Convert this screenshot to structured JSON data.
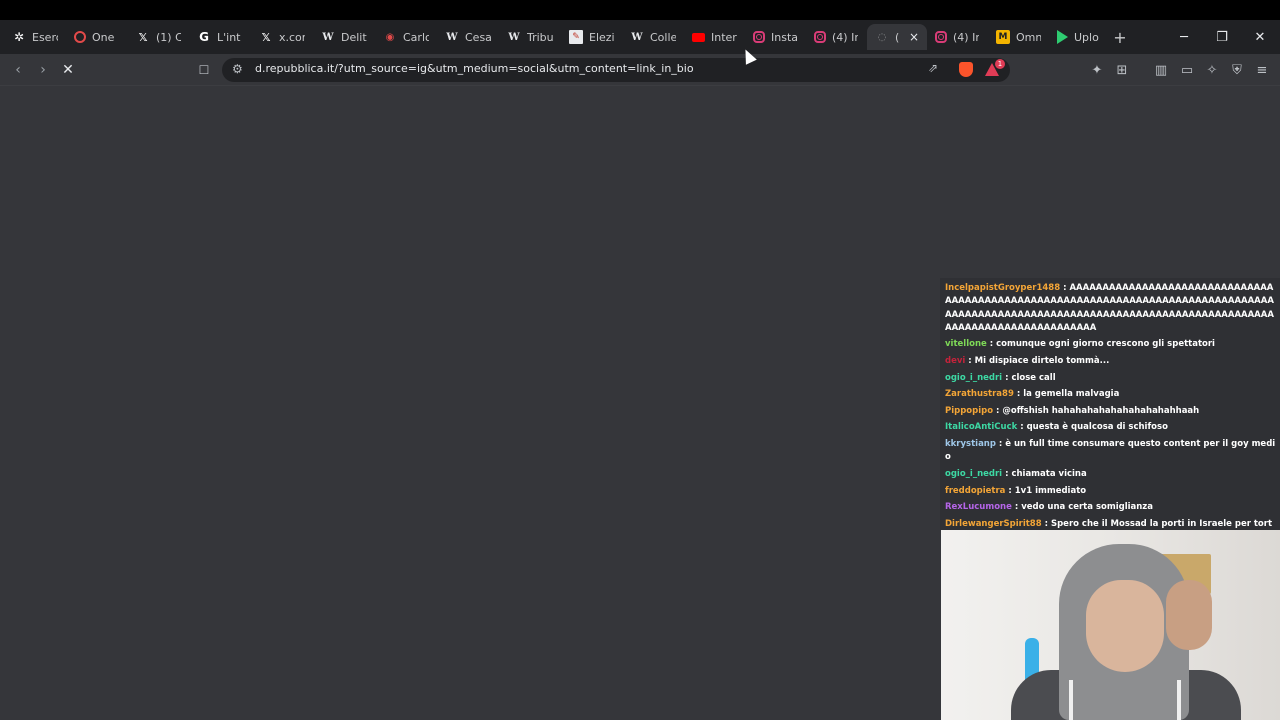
{
  "browser": {
    "tabs": [
      {
        "title": "Eserc",
        "icon": "openai-icon"
      },
      {
        "title": "One P",
        "icon": "onepiece-icon"
      },
      {
        "title": "(1) C",
        "icon": "x-icon"
      },
      {
        "title": "L'int",
        "icon": "google-icon"
      },
      {
        "title": "x.con",
        "icon": "x-icon"
      },
      {
        "title": "Delit",
        "icon": "wikipedia-icon"
      },
      {
        "title": "Carlo",
        "icon": "brave-icon"
      },
      {
        "title": "Cesa",
        "icon": "wikipedia-icon"
      },
      {
        "title": "Tribu",
        "icon": "wikipedia-icon"
      },
      {
        "title": "Elezi",
        "icon": "document-icon"
      },
      {
        "title": "Colle",
        "icon": "wikipedia-icon"
      },
      {
        "title": "Inter",
        "icon": "youtube-icon"
      },
      {
        "title": "Insta",
        "icon": "instagram-icon"
      },
      {
        "title": "(4) In",
        "icon": "instagram-icon"
      },
      {
        "title": "(",
        "icon": "loading-icon"
      },
      {
        "title": "(4) In",
        "icon": "instagram-icon"
      },
      {
        "title": "Omn",
        "icon": "m-icon"
      },
      {
        "title": "Uplo",
        "icon": "play-icon"
      }
    ],
    "close_tab_glyph": "×",
    "new_tab_glyph": "+",
    "window_controls": {
      "minimize": "─",
      "maximize": "❐",
      "close": "✕"
    },
    "url": "d.repubblica.it/?utm_source=ig&utm_medium=social&utm_content=link_in_bio"
  },
  "chat": {
    "messages": [
      {
        "user": "IncelpapistGroyper1488",
        "color": "#f3a537",
        "text": "AAAAAAAAAAAAAAAAAAAAAAAAAAAAAAAAAAAAAAAAAAAAAAAAAAAAAAAAAAAAAAAAAAAAAAAAAAAAAAAAAAAAAAAAAAAAAAAAAAAAAAAAAAAAAAAAAAAAAAAAAAAAAAAAAAAAAAAAAAAAAAAAAAAAAAAAAA"
      },
      {
        "user": "vitellone",
        "color": "#7ed957",
        "text": "comunque ogni giorno crescono gli spettatori"
      },
      {
        "user": "devi",
        "color": "#c4233b",
        "text": "Mi dispiace dirtelo tommà..."
      },
      {
        "user": "ogio_i_nedri",
        "color": "#3dd9a4",
        "text": "close call"
      },
      {
        "user": "Zarathustra89",
        "color": "#f3a537",
        "text": "la gemella malvagia"
      },
      {
        "user": "Pippopipo",
        "color": "#f3a537",
        "text": "@offshish hahahahahahahahahahahhaah"
      },
      {
        "user": "ItalicoAntiCuck",
        "color": "#3dd9a4",
        "text": "questa è qualcosa di schifoso"
      },
      {
        "user": "kkrystianp",
        "color": "#9fc7e8",
        "text": "è un full time consumare questo content per il goy medio"
      },
      {
        "user": "ogio_i_nedri",
        "color": "#3dd9a4",
        "text": "chiamata vicina"
      },
      {
        "user": "freddopietra",
        "color": "#f3a537",
        "text": "1v1 immediato"
      },
      {
        "user": "RexLucumone",
        "color": "#b565e8",
        "text": "vedo una certa somiglianza"
      },
      {
        "user": "DirlewangerSpirit88",
        "color": "#f3a537",
        "text": "Spero che il Mossad la porti in Israele per torturare i prigionieri politici"
      }
    ]
  }
}
